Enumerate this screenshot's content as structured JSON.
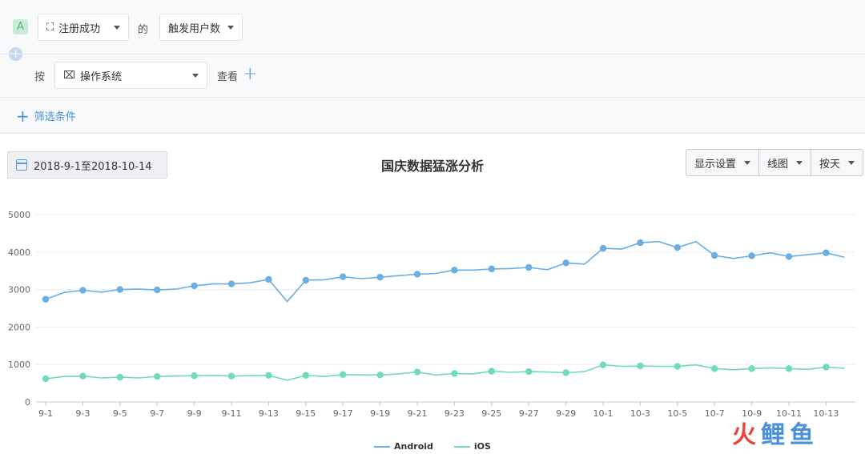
{
  "query": {
    "badge": "A",
    "event_select": "注册成功",
    "of_label": "的",
    "metric_select": "触发用户数",
    "by_label": "按",
    "group_select": "操作系统",
    "view_label": "查看",
    "filter_label": "筛选条件"
  },
  "toolbar": {
    "date_range": "2018-9-1至2018-10-14",
    "title": "国庆数据猛涨分析",
    "display_settings": "显示设置",
    "chart_type": "线图",
    "granularity": "按天"
  },
  "watermark": "火鲤鱼",
  "colors": {
    "android": "#6aaee3",
    "ios": "#6fdcb7"
  },
  "chart_data": {
    "type": "line",
    "x": [
      "9-1",
      "9-2",
      "9-3",
      "9-4",
      "9-5",
      "9-6",
      "9-7",
      "9-8",
      "9-9",
      "9-10",
      "9-11",
      "9-12",
      "9-13",
      "9-14",
      "9-15",
      "9-16",
      "9-17",
      "9-18",
      "9-19",
      "9-20",
      "9-21",
      "9-22",
      "9-23",
      "9-24",
      "9-25",
      "9-26",
      "9-27",
      "9-28",
      "9-29",
      "9-30",
      "10-1",
      "10-2",
      "10-3",
      "10-4",
      "10-5",
      "10-6",
      "10-7",
      "10-8",
      "10-9",
      "10-10",
      "10-11",
      "10-12",
      "10-13",
      "10-14"
    ],
    "xticks": [
      "9-1",
      "9-3",
      "9-5",
      "9-7",
      "9-9",
      "9-11",
      "9-13",
      "9-15",
      "9-17",
      "9-19",
      "9-21",
      "9-23",
      "9-25",
      "9-27",
      "9-29",
      "10-1",
      "10-3",
      "10-5",
      "10-7",
      "10-9",
      "10-11",
      "10-13"
    ],
    "yticks": [
      "0",
      "1000",
      "2000",
      "3000",
      "4000",
      "5000"
    ],
    "ylim": [
      0,
      5000
    ],
    "grid": true,
    "legend": "bottom-center",
    "series": [
      {
        "name": "Android",
        "values": [
          2740,
          2920,
          2980,
          2930,
          3000,
          3010,
          2990,
          3010,
          3100,
          3150,
          3150,
          3180,
          3270,
          2680,
          3250,
          3260,
          3340,
          3290,
          3330,
          3370,
          3410,
          3430,
          3520,
          3520,
          3550,
          3560,
          3590,
          3530,
          3710,
          3680,
          4100,
          4080,
          4250,
          4280,
          4120,
          4280,
          3910,
          3830,
          3900,
          3980,
          3880,
          3930,
          3980,
          3860
        ]
      },
      {
        "name": "iOS",
        "values": [
          620,
          680,
          690,
          640,
          660,
          640,
          680,
          690,
          700,
          710,
          690,
          700,
          710,
          580,
          710,
          680,
          730,
          720,
          720,
          750,
          800,
          720,
          760,
          750,
          820,
          790,
          810,
          800,
          780,
          810,
          990,
          950,
          960,
          950,
          950,
          990,
          890,
          860,
          890,
          910,
          890,
          870,
          930,
          900
        ]
      }
    ]
  }
}
